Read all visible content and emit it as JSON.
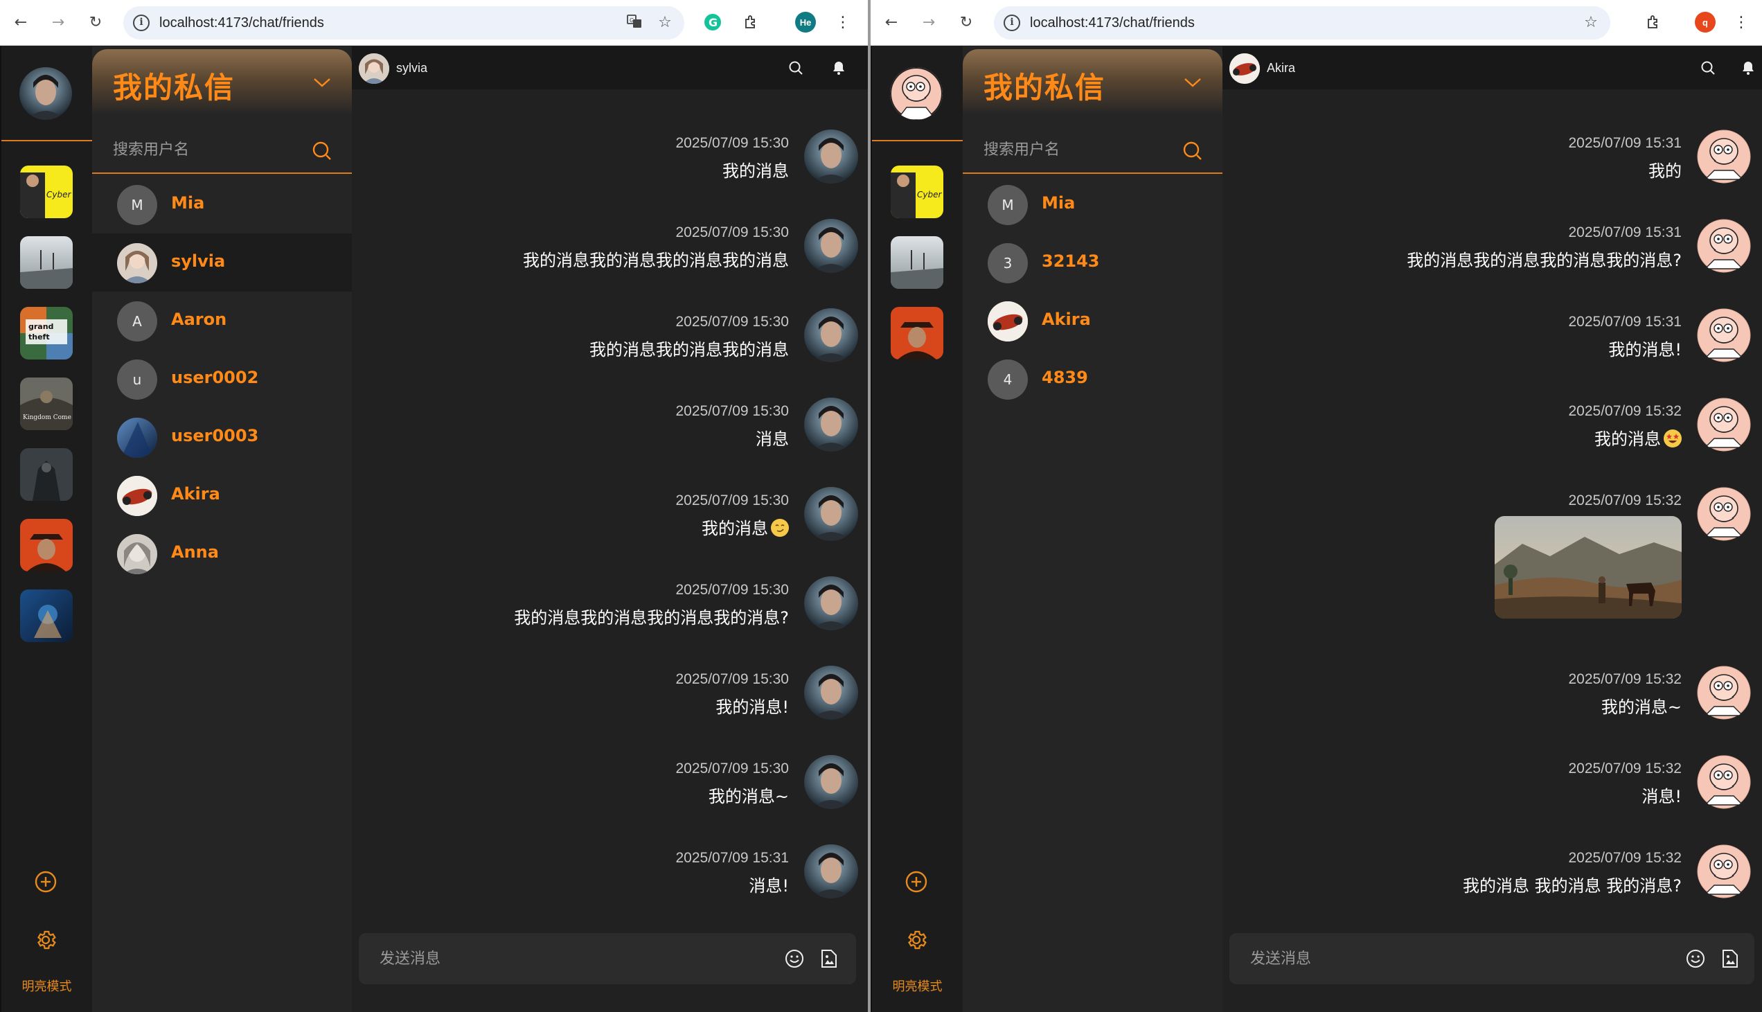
{
  "colors": {
    "accent": "#ff8a17",
    "background": "#212121",
    "rail": "#1c1c1c"
  },
  "left": {
    "browser": {
      "url": "localhost:4173/chat/friends",
      "profile_initials": "He",
      "profile_color": "#0f7b82"
    },
    "rail": {
      "mode_label": "明亮模式"
    },
    "panel": {
      "title": "我的私信",
      "search_placeholder": "搜索用户名"
    },
    "friends": [
      {
        "initial": "M",
        "name": "Mia",
        "avatar": "letter"
      },
      {
        "initial": "",
        "name": "sylvia",
        "avatar": "photo-girl"
      },
      {
        "initial": "A",
        "name": "Aaron",
        "avatar": "letter"
      },
      {
        "initial": "u",
        "name": "user0002",
        "avatar": "letter"
      },
      {
        "initial": "",
        "name": "user0003",
        "avatar": "photo-blue"
      },
      {
        "initial": "",
        "name": "Akira",
        "avatar": "photo-bike"
      },
      {
        "initial": "",
        "name": "Anna",
        "avatar": "photo-sketch"
      }
    ],
    "chat": {
      "name": "sylvia",
      "composer_placeholder": "发送消息",
      "messages": [
        {
          "time": "2025/07/09 15:30",
          "text": "我的消息"
        },
        {
          "time": "2025/07/09 15:30",
          "text": "我的消息我的消息我的消息我的消息"
        },
        {
          "time": "2025/07/09 15:30",
          "text": "我的消息我的消息我的消息"
        },
        {
          "time": "2025/07/09 15:30",
          "text": "消息"
        },
        {
          "time": "2025/07/09 15:30",
          "text": "我的消息",
          "emoji": "smirk-emoji"
        },
        {
          "time": "2025/07/09 15:30",
          "text": "我的消息我的消息我的消息我的消息?"
        },
        {
          "time": "2025/07/09 15:30",
          "text": "我的消息!"
        },
        {
          "time": "2025/07/09 15:30",
          "text": "我的消息~"
        },
        {
          "time": "2025/07/09 15:31",
          "text": "消息!"
        }
      ]
    }
  },
  "right": {
    "browser": {
      "url": "localhost:4173/chat/friends",
      "profile_initials": "q",
      "profile_color": "#e8471c"
    },
    "rail": {
      "mode_label": "明亮模式"
    },
    "panel": {
      "title": "我的私信",
      "search_placeholder": "搜索用户名"
    },
    "friends": [
      {
        "initial": "M",
        "name": "Mia",
        "avatar": "letter"
      },
      {
        "initial": "3",
        "name": "32143",
        "avatar": "letter"
      },
      {
        "initial": "",
        "name": "Akira",
        "avatar": "photo-bike"
      },
      {
        "initial": "4",
        "name": "4839",
        "avatar": "letter"
      }
    ],
    "chat": {
      "name": "Akira",
      "composer_placeholder": "发送消息",
      "messages": [
        {
          "time": "2025/07/09 15:31",
          "text": "我的"
        },
        {
          "time": "2025/07/09 15:31",
          "text": "我的消息我的消息我的消息我的消息?"
        },
        {
          "time": "2025/07/09 15:31",
          "text": "我的消息!"
        },
        {
          "time": "2025/07/09 15:32",
          "text": "我的消息",
          "emoji": "starstruck-emoji"
        },
        {
          "time": "2025/07/09 15:32",
          "text": "",
          "image": "landscape-horse-photo"
        },
        {
          "time": "2025/07/09 15:32",
          "text": "我的消息~"
        },
        {
          "time": "2025/07/09 15:32",
          "text": "消息!"
        },
        {
          "time": "2025/07/09 15:32",
          "text": "我的消息 我的消息 我的消息?"
        }
      ]
    }
  }
}
